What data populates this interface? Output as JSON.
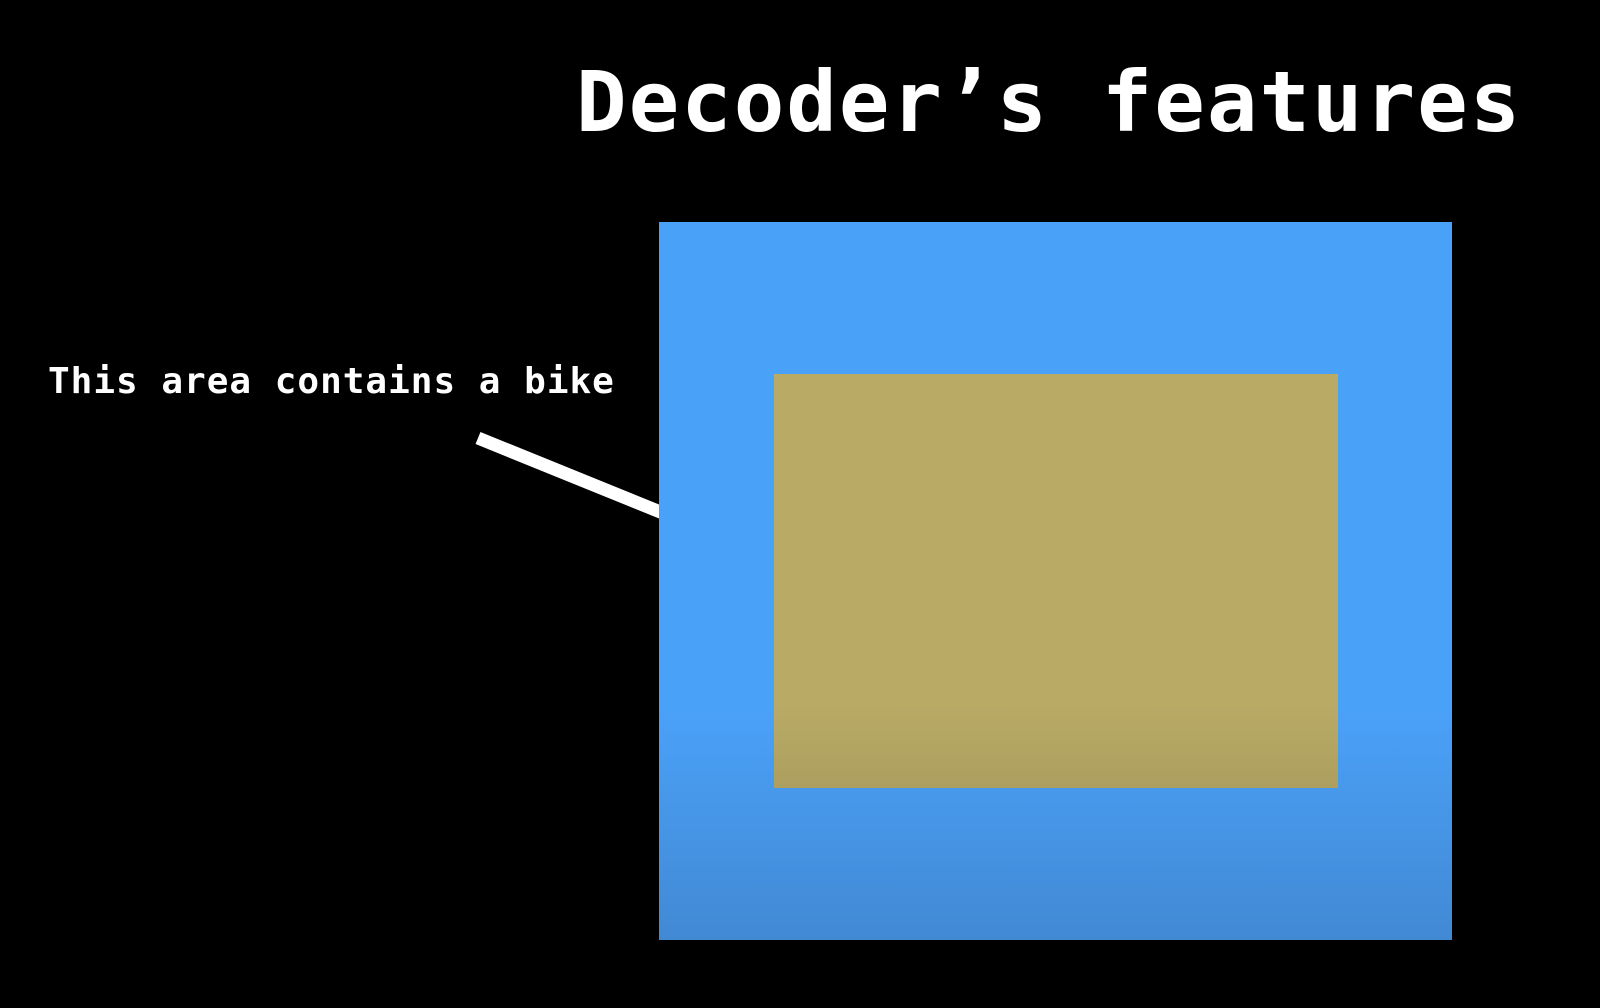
{
  "slide": {
    "title": "Decoder’s features",
    "annotation": "This area contains a bike"
  },
  "colors": {
    "background": "#000000",
    "text": "#ffffff",
    "feature_map": "#4aa1f8",
    "bike_region": "#b9ab66",
    "arrow": "#ffffff"
  }
}
